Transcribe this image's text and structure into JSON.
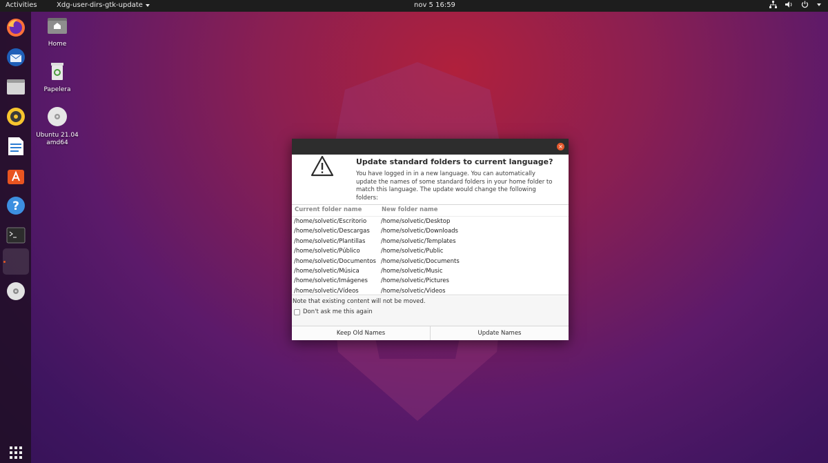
{
  "topbar": {
    "activities": "Activities",
    "app_name": "Xdg-user-dirs-gtk-update",
    "clock": "nov 5  16:59"
  },
  "dock": {
    "items": [
      {
        "icon": "firefox-icon"
      },
      {
        "icon": "thunderbird-icon"
      },
      {
        "icon": "files-icon"
      },
      {
        "icon": "rhythmbox-icon"
      },
      {
        "icon": "libreoffice-writer-icon"
      },
      {
        "icon": "software-center-icon"
      },
      {
        "icon": "help-icon"
      },
      {
        "icon": "terminal-icon"
      },
      {
        "icon": "running-app-icon"
      },
      {
        "icon": "disc-icon"
      },
      {
        "icon": "show-applications-icon"
      }
    ]
  },
  "desktop": {
    "home": "Home",
    "trash": "Papelera",
    "disc_line1": "Ubuntu 21.04",
    "disc_line2": "amd64"
  },
  "dialog": {
    "title": "Update standard folders to current language?",
    "message": "You have logged in in a new language. You can automatically update the names of some standard folders in your home folder to match this language. The update would change the following folders:",
    "columns": {
      "current": "Current folder name",
      "new": "New folder name"
    },
    "rows": [
      {
        "current": "/home/solvetic/Escritorio",
        "new": "/home/solvetic/Desktop"
      },
      {
        "current": "/home/solvetic/Descargas",
        "new": "/home/solvetic/Downloads"
      },
      {
        "current": "/home/solvetic/Plantillas",
        "new": "/home/solvetic/Templates"
      },
      {
        "current": "/home/solvetic/Público",
        "new": "/home/solvetic/Public"
      },
      {
        "current": "/home/solvetic/Documentos",
        "new": "/home/solvetic/Documents"
      },
      {
        "current": "/home/solvetic/Música",
        "new": "/home/solvetic/Music"
      },
      {
        "current": "/home/solvetic/Imágenes",
        "new": "/home/solvetic/Pictures"
      },
      {
        "current": "/home/solvetic/Vídeos",
        "new": "/home/solvetic/Videos"
      }
    ],
    "note": "Note that existing content will not be moved.",
    "checkbox_label": "Don't ask me this again",
    "checkbox_checked": false,
    "keep_button": "Keep Old Names",
    "update_button": "Update Names"
  },
  "colors": {
    "accent": "#e95420",
    "topbar": "#1d1d1d",
    "dialog_titlebar": "#2d2d2d"
  }
}
